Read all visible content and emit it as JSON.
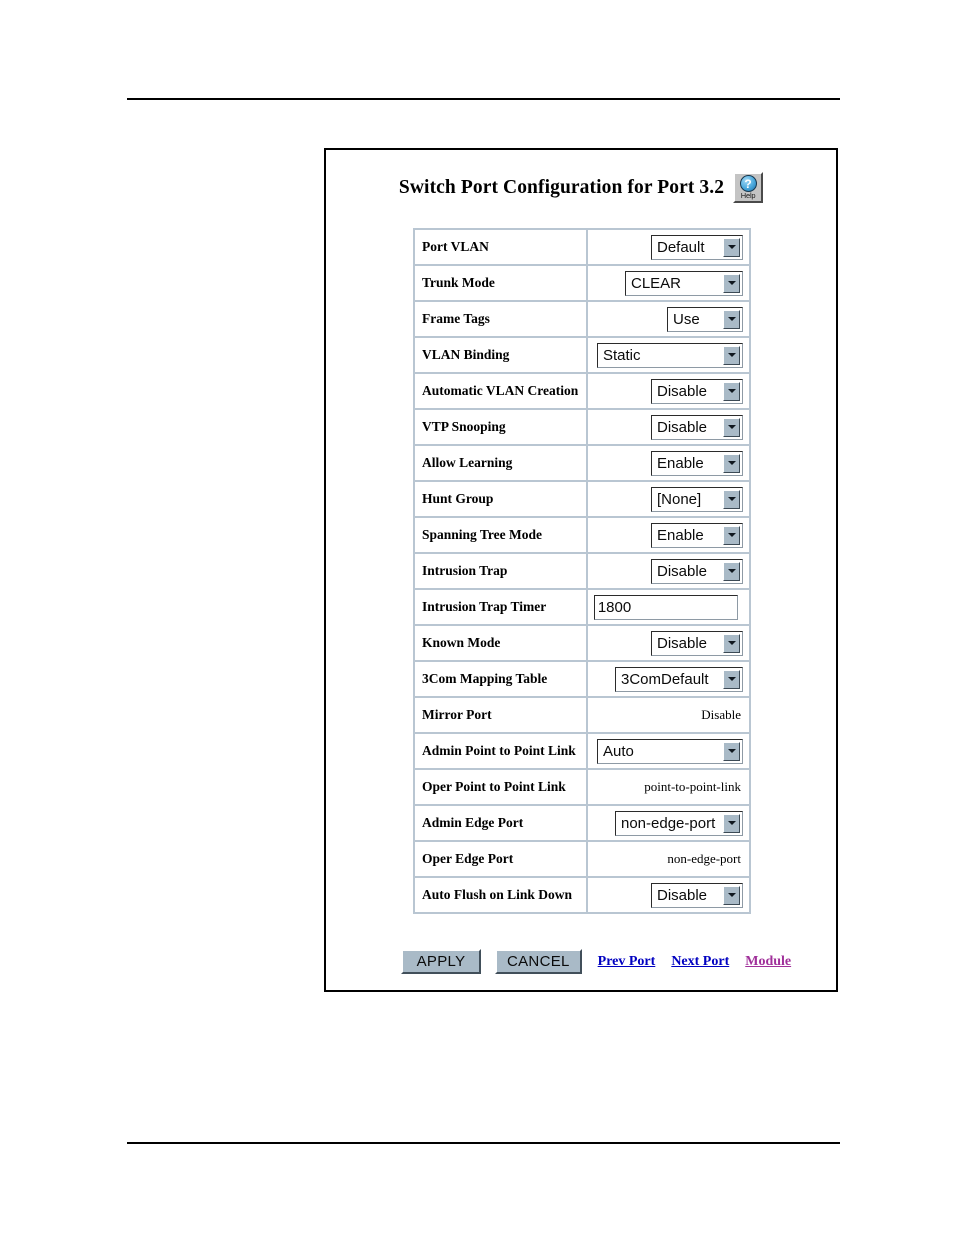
{
  "figure": {
    "title": "Switch Port Configuration for Port 3.2",
    "help_button": {
      "icon": "question-mark-help-icon",
      "label": "Help"
    }
  },
  "settings": {
    "rows": [
      {
        "label": "Port VLAN",
        "control": "select",
        "value": "Default",
        "width": "sel-w-92"
      },
      {
        "label": "Trunk Mode",
        "control": "select",
        "value": "CLEAR",
        "width": "sel-w-118"
      },
      {
        "label": "Frame Tags",
        "control": "select",
        "value": "Use",
        "width": "sel-w-76"
      },
      {
        "label": "VLAN Binding",
        "control": "select",
        "value": "Static",
        "width": "sel-w-146"
      },
      {
        "label": "Automatic VLAN Creation",
        "control": "select",
        "value": "Disable",
        "width": "sel-w-92"
      },
      {
        "label": "VTP Snooping",
        "control": "select",
        "value": "Disable",
        "width": "sel-w-92"
      },
      {
        "label": "Allow Learning",
        "control": "select",
        "value": "Enable",
        "width": "sel-w-92"
      },
      {
        "label": "Hunt Group",
        "control": "select",
        "value": "[None]",
        "width": "sel-w-92"
      },
      {
        "label": "Spanning Tree Mode",
        "control": "select",
        "value": "Enable",
        "width": "sel-w-92"
      },
      {
        "label": "Intrusion Trap",
        "control": "select",
        "value": "Disable",
        "width": "sel-w-92"
      },
      {
        "label": "Intrusion Trap Timer",
        "control": "text",
        "value": "1800",
        "width": ""
      },
      {
        "label": "Known Mode",
        "control": "select",
        "value": "Disable",
        "width": "sel-w-92"
      },
      {
        "label": "3Com Mapping Table",
        "control": "select",
        "value": "3ComDefault",
        "width": "sel-w-128"
      },
      {
        "label": "Mirror Port",
        "control": "readonly",
        "value": "Disable",
        "width": ""
      },
      {
        "label": "Admin Point to Point Link",
        "control": "select",
        "value": "Auto",
        "width": "sel-w-146"
      },
      {
        "label": "Oper Point to Point Link",
        "control": "readonly",
        "value": "point-to-point-link",
        "width": ""
      },
      {
        "label": "Admin Edge Port",
        "control": "select",
        "value": "non-edge-port",
        "width": "sel-w-128"
      },
      {
        "label": "Oper Edge Port",
        "control": "readonly",
        "value": "non-edge-port",
        "width": ""
      },
      {
        "label": "Auto Flush on Link Down",
        "control": "select",
        "value": "Disable",
        "width": "sel-w-92"
      }
    ]
  },
  "actions": {
    "apply_label": "APPLY",
    "cancel_label": "CANCEL",
    "links": [
      {
        "label": "Prev Port",
        "visited": false
      },
      {
        "label": "Next Port",
        "visited": false
      },
      {
        "label": "Module",
        "visited": true
      }
    ]
  },
  "colors": {
    "link": "#0000c0",
    "visited_link": "#a0309a",
    "button_face": "#a9bac7",
    "cell_border": "#b9c6d2"
  }
}
